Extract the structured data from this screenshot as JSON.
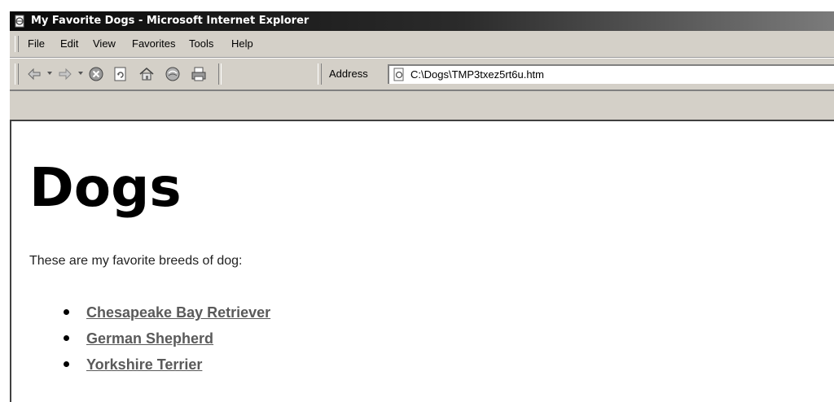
{
  "window": {
    "title": "My Favorite Dogs - Microsoft Internet Explorer"
  },
  "menu": {
    "items": [
      "File",
      "Edit",
      "View",
      "Favorites",
      "Tools",
      "Help"
    ]
  },
  "toolbar": {
    "icons": [
      "back-icon",
      "forward-icon",
      "stop-icon",
      "refresh-icon",
      "home-icon",
      "search-icon",
      "print-icon"
    ],
    "address_label": "Address",
    "address_value": "C:\\Dogs\\TMP3txez5rt6u.htm"
  },
  "page": {
    "heading": "Dogs",
    "intro": "These are my favorite breeds of dog:",
    "breeds": [
      "Chesapeake Bay Retriever",
      "German Shepherd",
      "Yorkshire Terrier"
    ]
  }
}
